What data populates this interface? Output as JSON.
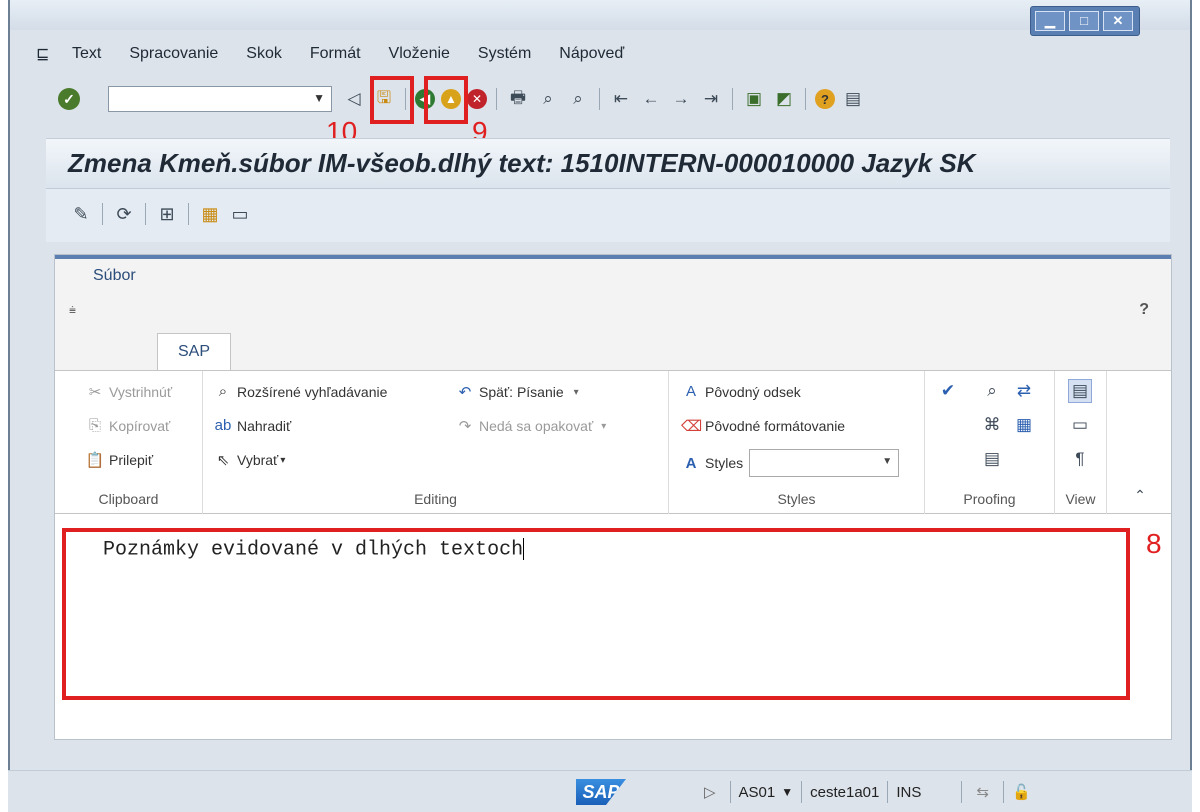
{
  "menu": {
    "items": [
      "Text",
      "Spracovanie",
      "Skok",
      "Formát",
      "Vloženie",
      "Systém",
      "Nápoveď"
    ]
  },
  "toolbar": {
    "command_value": ""
  },
  "annotations": {
    "save": "10",
    "back": "9",
    "editor": "8"
  },
  "screen": {
    "title": "Zmena Kmeň.súbor IM-všeob.dlhý text: 1510INTERN-000010000 Jazyk SK"
  },
  "editor": {
    "file_tab": "Súbor",
    "qat_symbol": "⩧",
    "help": "?",
    "ribbon_tab": "SAP",
    "clipboard": {
      "label": "Clipboard",
      "cut": "Vystrihnúť",
      "copy": "Kopírovať",
      "paste": "Prilepiť"
    },
    "editing": {
      "label": "Editing",
      "advanced_find": "Rozšírené vyhľadávanie",
      "replace": "Nahradiť",
      "select": "Vybrať",
      "undo": "Späť: Písanie",
      "redo": "Nedá sa opakovať"
    },
    "styles": {
      "label": "Styles",
      "reset_paragraph": "Pôvodný odsek",
      "reset_format": "Pôvodné formátovanie",
      "styles": "Styles",
      "styles_value": ""
    },
    "proofing": {
      "label": "Proofing"
    },
    "view": {
      "label": "View"
    },
    "document_text": "Poznámky evidované v dlhých textoch"
  },
  "status": {
    "system": "AS01",
    "server": "ceste1a01",
    "mode": "INS"
  }
}
